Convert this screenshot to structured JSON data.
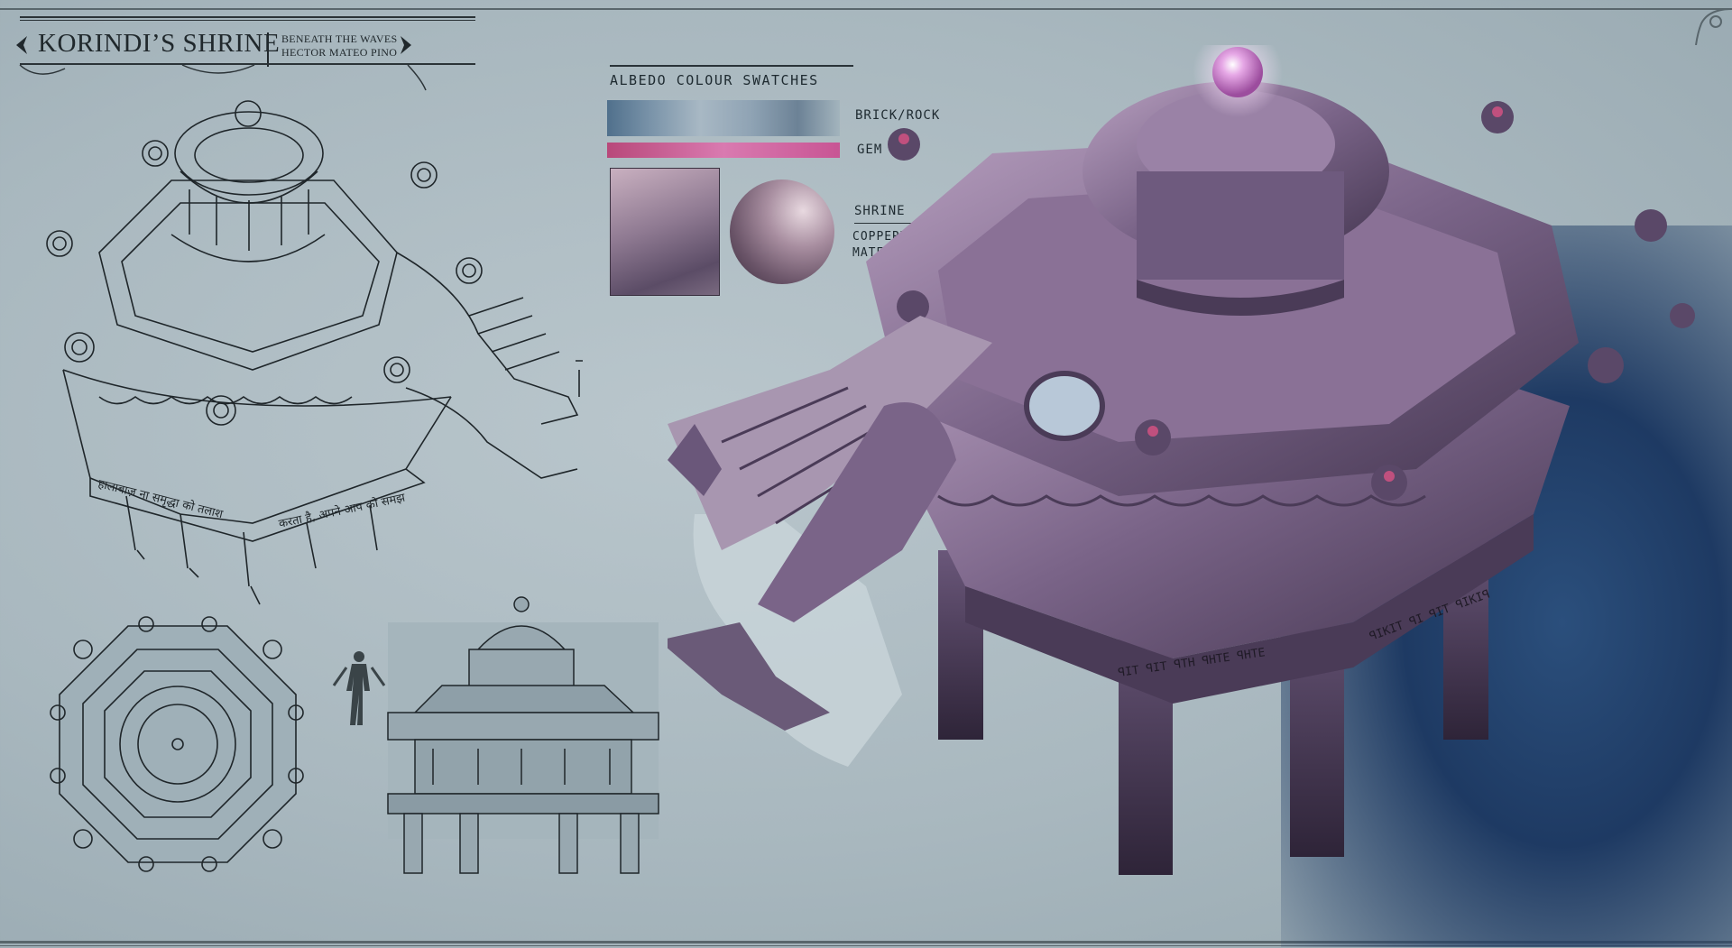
{
  "title": {
    "main": "KORINDI’S SHRINE",
    "subtitle_line1": "BENEATH THE WAVES",
    "subtitle_line2": "HECTOR MATEO PINO"
  },
  "swatches": {
    "heading": "ALBEDO COLOUR SWATCHES",
    "brick_label": "BRICK/ROCK",
    "gem_label": "GEM",
    "shrine_label": "SHRINE",
    "material_line1": "COPPERY",
    "material_line2": "MATERIAL",
    "colors": {
      "brick": "#7892a8",
      "gem": "#d97ab0",
      "copper": "#a88ea0"
    }
  },
  "sketch": {
    "banner_left": "हालाबाज़ ना समृद्धा को तलाश",
    "banner_right": "करता है, अपने आप को समझ"
  },
  "painting": {
    "banner_left": "ꟼIT ꟼIT ꟼTH ꟼHTE ꟼHTE",
    "banner_right": "ꟼIKIT ꟼI ꟼIT ꟼIKIꟼ"
  },
  "icons": {
    "title_arrow_left": "ornament-arrow-left-icon",
    "title_arrow_right": "ornament-arrow-right-icon",
    "corner": "corner-ornament-icon"
  }
}
